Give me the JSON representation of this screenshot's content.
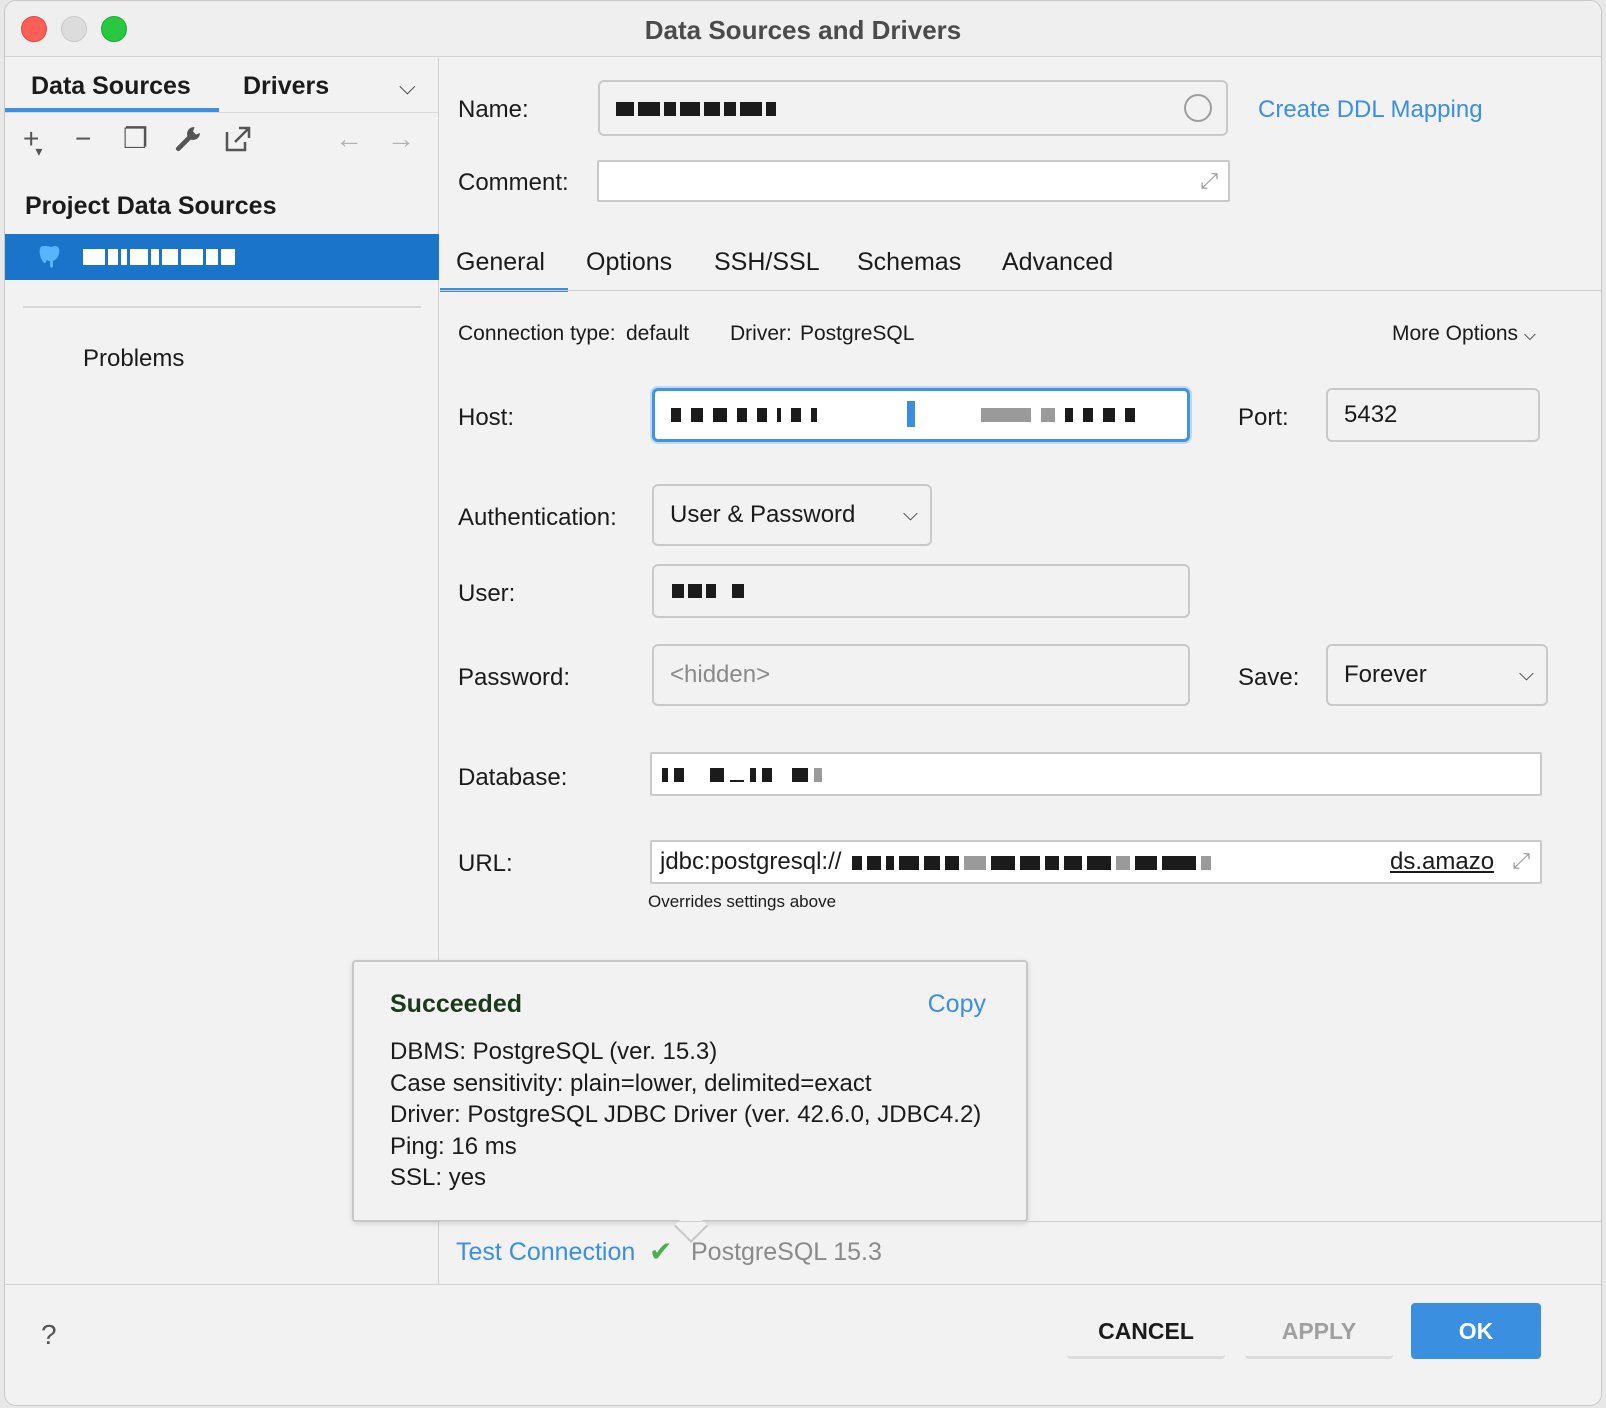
{
  "window": {
    "title": "Data Sources and Drivers"
  },
  "sidebar": {
    "tabs": [
      {
        "label": "Data Sources"
      },
      {
        "label": "Drivers"
      }
    ],
    "section_title": "Project Data Sources",
    "problems_label": "Problems"
  },
  "form": {
    "name_label": "Name:",
    "comment_label": "Comment:",
    "create_ddl_link": "Create DDL Mapping",
    "tabs": [
      {
        "label": "General"
      },
      {
        "label": "Options"
      },
      {
        "label": "SSH/SSL"
      },
      {
        "label": "Schemas"
      },
      {
        "label": "Advanced"
      }
    ],
    "connection_type_label": "Connection type:",
    "connection_type_value": "default",
    "driver_label": "Driver:",
    "driver_value": "PostgreSQL",
    "more_options": "More Options",
    "host_label": "Host:",
    "port_label": "Port:",
    "port_value": "5432",
    "auth_label": "Authentication:",
    "auth_value": "User & Password",
    "user_label": "User:",
    "password_label": "Password:",
    "password_placeholder": "<hidden>",
    "save_label": "Save:",
    "save_value": "Forever",
    "database_label": "Database:",
    "url_label": "URL:",
    "url_prefix": "jdbc:postgresql://",
    "url_suffix": "ds.amazo",
    "url_hint": "Overrides settings above"
  },
  "test_popup": {
    "title": "Succeeded",
    "copy_label": "Copy",
    "lines": [
      "DBMS: PostgreSQL (ver. 15.3)",
      "Case sensitivity: plain=lower, delimited=exact",
      "Driver: PostgreSQL JDBC Driver (ver. 42.6.0, JDBC4.2)",
      "Ping: 16 ms",
      "SSL: yes"
    ]
  },
  "test_connection": {
    "label": "Test Connection",
    "result": "PostgreSQL 15.3"
  },
  "footer": {
    "help": "?",
    "cancel": "CANCEL",
    "apply": "APPLY",
    "ok": "OK"
  },
  "colors": {
    "accent": "#3b8fe0",
    "selection": "#1a74c9",
    "success": "#4caf50"
  }
}
